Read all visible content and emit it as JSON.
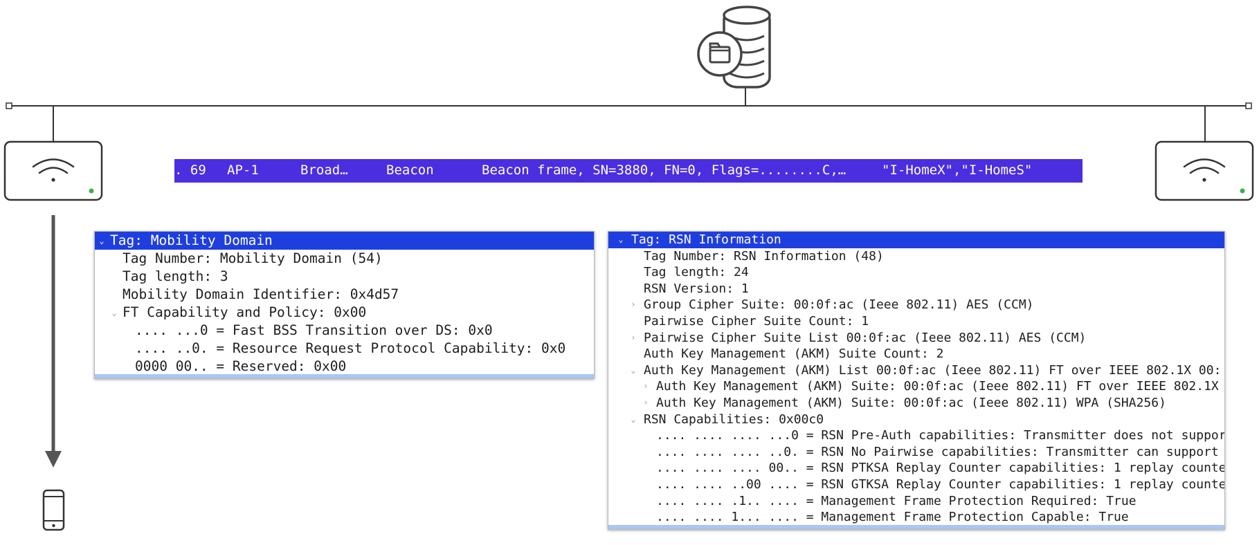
{
  "packet_row": {
    "number": ". 69",
    "source": "AP-1",
    "destination": "Broad…",
    "protocol": "Beacon",
    "info": "Beacon frame, SN=3880, FN=0, Flags=........C,…",
    "ssids": "\"I-HomeX\",\"I-HomeS\""
  },
  "mobility_domain_panel": {
    "lines": [
      {
        "text": "Tag: Mobility Domain",
        "indent": 0,
        "caret": "down",
        "selected": true
      },
      {
        "text": "Tag Number: Mobility Domain (54)",
        "indent": 1,
        "caret": "",
        "selected": false
      },
      {
        "text": "Tag length: 3",
        "indent": 1,
        "caret": "",
        "selected": false
      },
      {
        "text": "Mobility Domain Identifier: 0x4d57",
        "indent": 1,
        "caret": "",
        "selected": false
      },
      {
        "text": "FT Capability and Policy: 0x00",
        "indent": 1,
        "caret": "down",
        "selected": false
      },
      {
        "text": ".... ...0 = Fast BSS Transition over DS: 0x0",
        "indent": 2,
        "caret": "",
        "selected": false
      },
      {
        "text": ".... ..0. = Resource Request Protocol Capability: 0x0",
        "indent": 2,
        "caret": "",
        "selected": false
      },
      {
        "text": "0000 00.. = Reserved: 0x00",
        "indent": 2,
        "caret": "",
        "selected": false
      }
    ]
  },
  "rsn_panel": {
    "lines": [
      {
        "text": "Tag: RSN Information",
        "indent": 0,
        "caret": "down",
        "selected": true
      },
      {
        "text": "Tag Number: RSN Information (48)",
        "indent": 1,
        "caret": "",
        "selected": false
      },
      {
        "text": "Tag length: 24",
        "indent": 1,
        "caret": "",
        "selected": false
      },
      {
        "text": "RSN Version: 1",
        "indent": 1,
        "caret": "",
        "selected": false
      },
      {
        "text": "Group Cipher Suite: 00:0f:ac (Ieee 802.11) AES (CCM)",
        "indent": 1,
        "caret": "right",
        "selected": false
      },
      {
        "text": "Pairwise Cipher Suite Count: 1",
        "indent": 1,
        "caret": "",
        "selected": false
      },
      {
        "text": "Pairwise Cipher Suite List 00:0f:ac (Ieee 802.11) AES (CCM)",
        "indent": 1,
        "caret": "right",
        "selected": false
      },
      {
        "text": "Auth Key Management (AKM) Suite Count: 2",
        "indent": 1,
        "caret": "",
        "selected": false
      },
      {
        "text": "Auth Key Management (AKM) List 00:0f:ac (Ieee 802.11) FT over IEEE 802.1X 00:",
        "indent": 1,
        "caret": "down",
        "selected": false
      },
      {
        "text": "Auth Key Management (AKM) Suite: 00:0f:ac (Ieee 802.11) FT over IEEE 802.1X",
        "indent": 2,
        "caret": "right",
        "selected": false
      },
      {
        "text": "Auth Key Management (AKM) Suite: 00:0f:ac (Ieee 802.11) WPA (SHA256)",
        "indent": 2,
        "caret": "right",
        "selected": false
      },
      {
        "text": "RSN Capabilities: 0x00c0",
        "indent": 1,
        "caret": "down",
        "selected": false
      },
      {
        "text": ".... .... .... ...0 = RSN Pre-Auth capabilities: Transmitter does not suppor",
        "indent": 2,
        "caret": "",
        "selected": false
      },
      {
        "text": ".... .... .... ..0. = RSN No Pairwise capabilities: Transmitter can support",
        "indent": 2,
        "caret": "",
        "selected": false
      },
      {
        "text": ".... .... .... 00.. = RSN PTKSA Replay Counter capabilities: 1 replay counte",
        "indent": 2,
        "caret": "",
        "selected": false
      },
      {
        "text": ".... .... ..00 .... = RSN GTKSA Replay Counter capabilities: 1 replay counte",
        "indent": 2,
        "caret": "",
        "selected": false
      },
      {
        "text": ".... .... .1.. .... = Management Frame Protection Required: True",
        "indent": 2,
        "caret": "",
        "selected": false
      },
      {
        "text": ".... .... 1... .... = Management Frame Protection Capable: True",
        "indent": 2,
        "caret": "",
        "selected": false
      }
    ]
  },
  "icons": {
    "server": "database-server-icon",
    "access_point_left": "wifi-access-point-icon",
    "access_point_right": "wifi-access-point-icon",
    "client": "smartphone-icon"
  },
  "colors": {
    "packet_row_bg": "#4a2ee0",
    "selection_bg": "#1f3ee0",
    "line": "#333333",
    "arrow": "#555555",
    "status_led": "#3cb043"
  }
}
